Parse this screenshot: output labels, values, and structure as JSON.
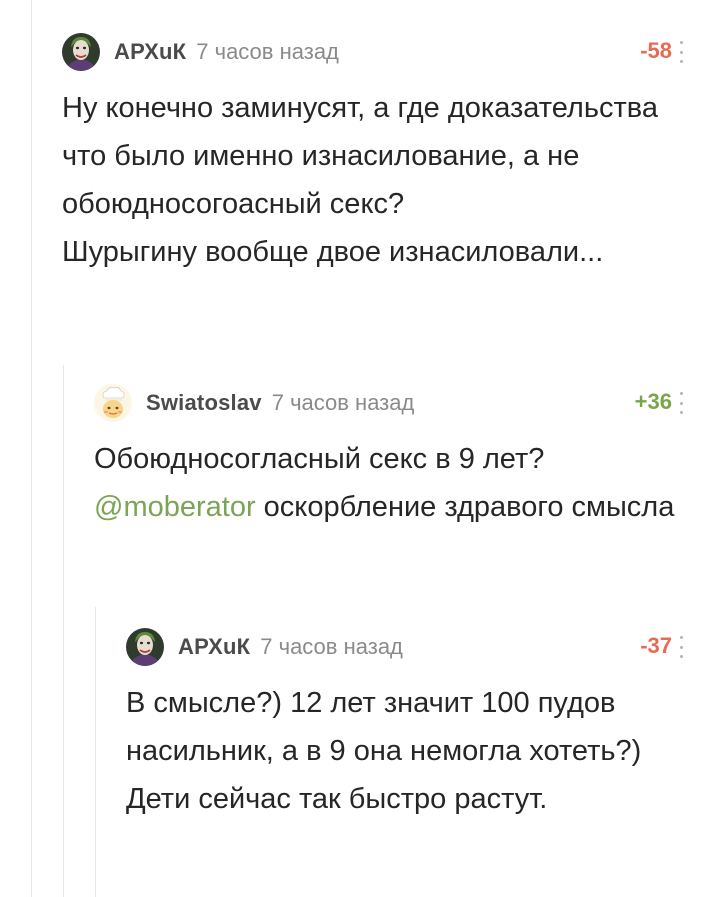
{
  "comments": [
    {
      "username": "АРХuК",
      "timestamp": "7 часов назад",
      "rating": "-58",
      "rating_type": "negative",
      "avatar": "joker-avatar",
      "body": [
        "Ну конечно заминусят, а где доказательства что было именно изнасилование, а не обоюдносогоасный секс?",
        "Шурыгину вообще двое изнасиловали..."
      ]
    },
    {
      "username": "Swiatoslav",
      "timestamp": "7 часов назад",
      "rating": "+36",
      "rating_type": "positive",
      "avatar": "chef-avatar",
      "body_line1": "Обоюдносогласный секс в 9 лет?",
      "mention": "@moberator",
      "body_rest": " оскорбление здравого смысла"
    },
    {
      "username": "АРХuК",
      "timestamp": "7 часов назад",
      "rating": "-37",
      "rating_type": "negative",
      "avatar": "joker-avatar",
      "body": [
        "В смысле?) 12 лет значит 100 пудов насильник, а в 9 она немогла хотеть?) Дети сейчас так быстро растут."
      ]
    }
  ],
  "colors": {
    "negative": "#e86a54",
    "positive": "#7aa64a",
    "mention": "#7ba456",
    "thread_line": "#e6e6e6"
  }
}
